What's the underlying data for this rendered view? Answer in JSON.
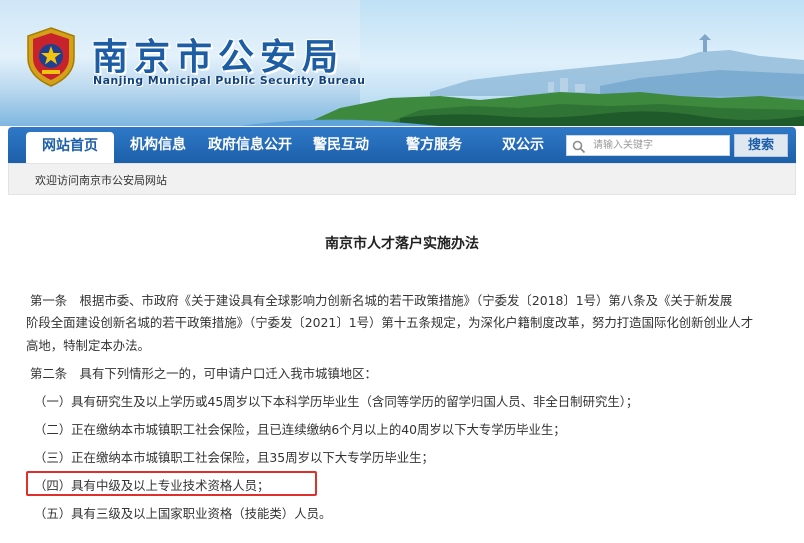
{
  "header": {
    "title": "南京市公安局",
    "subtitle": "Nanjing Municipal Public Security Bureau"
  },
  "nav": {
    "items": [
      {
        "label": "网站首页",
        "active": true
      },
      {
        "label": "机构信息",
        "active": false
      },
      {
        "label": "政府信息公开",
        "active": false
      },
      {
        "label": "警民互动",
        "active": false
      },
      {
        "label": "警方服务",
        "active": false
      },
      {
        "label": "双公示",
        "active": false
      }
    ],
    "search_placeholder": "请输入关键字",
    "search_button": "搜索"
  },
  "welcome": "欢迎访问南京市公安局网站",
  "article": {
    "title": "南京市人才落户实施办法",
    "paragraph1_lines": [
      "第一条　根据市委、市政府《关于建设具有全球影响力创新名城的若干政策措施》（宁委发〔2018〕1号）第八条及《关于新发展",
      "阶段全面建设创新名城的若干政策措施》（宁委发〔2021〕1号）第十五条规定，为深化户籍制度改革，努力打造国际化创新创业人才",
      "高地，特制定本办法。"
    ],
    "paragraph2": "第二条　具有下列情形之一的，可申请户口迁入我市城镇地区：",
    "items": [
      "（一）具有研究生及以上学历或45周岁以下本科学历毕业生（含同等学历的留学归国人员、非全日制研究生）；",
      "（二）正在缴纳本市城镇职工社会保险，且已连续缴纳6个月以上的40周岁以下大专学历毕业生；",
      "（三）正在缴纳本市城镇职工社会保险，且35周岁以下大专学历毕业生；",
      "（四）具有中级及以上专业技术资格人员；",
      "（五）具有三级及以上国家职业资格（技能类）人员。"
    ]
  },
  "colors": {
    "nav_blue": "#1d5fa9",
    "title_blue": "#1c5da3",
    "highlight_red": "#e0302e"
  },
  "icons": {
    "emblem": "police-emblem-icon",
    "search": "search-icon"
  }
}
